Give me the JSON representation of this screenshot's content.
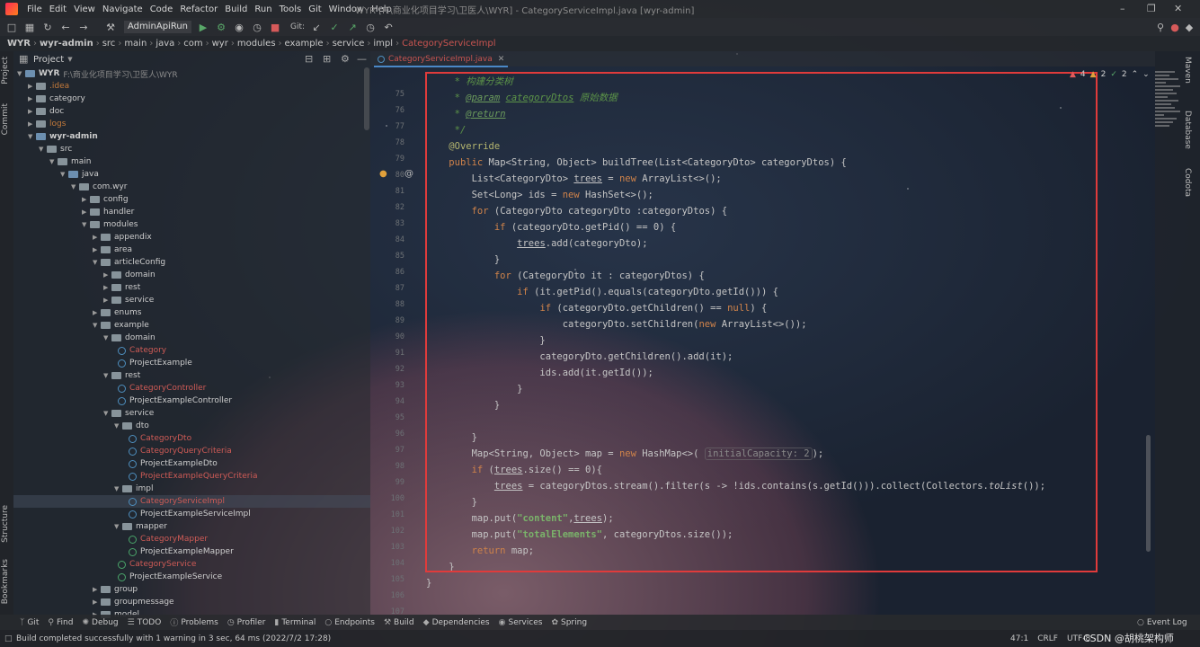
{
  "menubar": {
    "items": [
      "File",
      "Edit",
      "View",
      "Navigate",
      "Code",
      "Refactor",
      "Build",
      "Run",
      "Tools",
      "Git",
      "Window",
      "Help"
    ],
    "window_title": "WYR [F:\\商业化项目学习\\卫医人\\WYR] - CategoryServiceImpl.java [wyr-admin]"
  },
  "toolbar": {
    "run_config": "AdminApiRun",
    "git_label": "Git:"
  },
  "breadcrumb": [
    "WYR",
    "wyr-admin",
    "src",
    "main",
    "java",
    "com",
    "wyr",
    "modules",
    "example",
    "service",
    "impl",
    "CategoryServiceImpl"
  ],
  "project_panel": {
    "title": "Project",
    "root_label": "WYR",
    "root_path": "F:\\商业化项目学习\\卫医人\\WYR",
    "tree": [
      {
        "label": ".idea",
        "style": "orange"
      },
      {
        "label": "category",
        "style": ""
      },
      {
        "label": "doc",
        "style": ""
      },
      {
        "label": "logs",
        "style": "orange"
      },
      {
        "label": "wyr-admin",
        "style": "bold"
      },
      {
        "label": "src",
        "style": ""
      },
      {
        "label": "main",
        "style": ""
      },
      {
        "label": "java",
        "style": ""
      },
      {
        "label": "com.wyr",
        "style": ""
      },
      {
        "label": "config",
        "style": ""
      },
      {
        "label": "handler",
        "style": ""
      },
      {
        "label": "modules",
        "style": ""
      },
      {
        "label": "appendix",
        "style": ""
      },
      {
        "label": "area",
        "style": ""
      },
      {
        "label": "articleConfig",
        "style": ""
      },
      {
        "label": "domain",
        "style": ""
      },
      {
        "label": "rest",
        "style": ""
      },
      {
        "label": "service",
        "style": ""
      },
      {
        "label": "enums",
        "style": ""
      },
      {
        "label": "example",
        "style": ""
      },
      {
        "label": "domain",
        "style": ""
      },
      {
        "label": "Category",
        "style": "red"
      },
      {
        "label": "ProjectExample",
        "style": ""
      },
      {
        "label": "rest",
        "style": ""
      },
      {
        "label": "CategoryController",
        "style": "red"
      },
      {
        "label": "ProjectExampleController",
        "style": ""
      },
      {
        "label": "service",
        "style": ""
      },
      {
        "label": "dto",
        "style": ""
      },
      {
        "label": "CategoryDto",
        "style": "red"
      },
      {
        "label": "CategoryQueryCriteria",
        "style": "red"
      },
      {
        "label": "ProjectExampleDto",
        "style": ""
      },
      {
        "label": "ProjectExampleQueryCriteria",
        "style": "red"
      },
      {
        "label": "impl",
        "style": ""
      },
      {
        "label": "CategoryServiceImpl",
        "style": "red"
      },
      {
        "label": "ProjectExampleServiceImpl",
        "style": ""
      },
      {
        "label": "mapper",
        "style": ""
      },
      {
        "label": "CategoryMapper",
        "style": "red"
      },
      {
        "label": "ProjectExampleMapper",
        "style": ""
      },
      {
        "label": "CategoryService",
        "style": "red"
      },
      {
        "label": "ProjectExampleService",
        "style": ""
      },
      {
        "label": "group",
        "style": ""
      },
      {
        "label": "groupmessage",
        "style": ""
      },
      {
        "label": "model",
        "style": ""
      }
    ]
  },
  "left_strip": {
    "project": "Project",
    "commit": "Commit",
    "structure": "Structure",
    "bookmarks": "Bookmarks"
  },
  "right_strip": {
    "maven": "Maven",
    "database": "Database",
    "codota": "Codota"
  },
  "editor": {
    "tab_label": "CategoryServiceImpl.java",
    "line_numbers": [
      "75",
      "76",
      "77",
      "78",
      "79",
      "80",
      "81",
      "82",
      "83",
      "84",
      "85",
      "86",
      "87",
      "88",
      "89",
      "90",
      "91",
      "92",
      "93",
      "94",
      "95",
      "96",
      "97",
      "98",
      "99",
      "100",
      "101",
      "102",
      "103",
      "104",
      "105",
      "106",
      "107"
    ],
    "indicators": {
      "warnings": "4",
      "errors": "2",
      "ok": "2"
    },
    "comment_1": " * 构建分类树",
    "param_tag": "@param",
    "param_name": "categoryDtos",
    "param_desc": "原始数据",
    "return_tag": "@return",
    "comment_end": " */",
    "annotation": "@Override",
    "hint_initial_capacity": "initialCapacity: 2",
    "str_content": "\"content\"",
    "str_total": "\"totalElements\""
  },
  "bottom_tools": [
    "Git",
    "Find",
    "Debug",
    "TODO",
    "Problems",
    "Profiler",
    "Terminal",
    "Endpoints",
    "Build",
    "Dependencies",
    "Services",
    "Spring"
  ],
  "event_log": "Event Log",
  "status": {
    "message": "Build completed successfully with 1 warning in 3 sec, 64 ms (2022/7/2 17:28)",
    "position": "47:1",
    "line_sep": "CRLF",
    "encoding": "UTF-8"
  },
  "watermark": "CSDN @胡桃架构师"
}
